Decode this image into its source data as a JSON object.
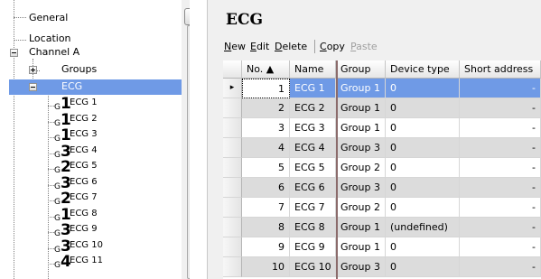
{
  "tree": {
    "top_items": [
      {
        "label": "General"
      },
      {
        "label": "Location"
      },
      {
        "label": "Channel A"
      }
    ],
    "channel_children": [
      {
        "label": "Groups"
      },
      {
        "label": "ECG"
      }
    ],
    "ecg_items": [
      {
        "prefix": "G",
        "num": "1",
        "label": "ECG 1"
      },
      {
        "prefix": "G",
        "num": "1",
        "label": "ECG 2"
      },
      {
        "prefix": "G",
        "num": "1",
        "label": "ECG 3"
      },
      {
        "prefix": "G",
        "num": "3",
        "label": "ECG 4"
      },
      {
        "prefix": "G",
        "num": "2",
        "label": "ECG 5"
      },
      {
        "prefix": "G",
        "num": "3",
        "label": "ECG 6"
      },
      {
        "prefix": "G",
        "num": "2",
        "label": "ECG 7"
      },
      {
        "prefix": "G",
        "num": "1",
        "label": "ECG 8"
      },
      {
        "prefix": "G",
        "num": "3",
        "label": "ECG 9"
      },
      {
        "prefix": "G",
        "num": "3",
        "label": "ECG 10"
      },
      {
        "prefix": "G",
        "num": "4",
        "label": "ECG 11"
      }
    ],
    "scroll_up_icon": "chevron-up-icon",
    "grip_icon": "scrollbar-grip-icon"
  },
  "panel": {
    "title": "ECG"
  },
  "toolbar": {
    "new": {
      "key": "N",
      "rest": "ew"
    },
    "edit": {
      "key": "E",
      "rest": "dit"
    },
    "delete": {
      "key": "D",
      "rest": "elete"
    },
    "copy": {
      "key": "C",
      "rest": "opy"
    },
    "paste": {
      "key": "P",
      "rest": "aste"
    }
  },
  "grid": {
    "columns": [
      "No. ▲",
      "Name",
      "Group",
      "Device type",
      "Short address"
    ],
    "selected_marker": "▸",
    "rows": [
      {
        "no": "1",
        "name": "ECG 1",
        "group": "Group 1",
        "device_type": "0",
        "short_address": "-"
      },
      {
        "no": "2",
        "name": "ECG 2",
        "group": "Group 1",
        "device_type": "0",
        "short_address": "-"
      },
      {
        "no": "3",
        "name": "ECG 3",
        "group": "Group 1",
        "device_type": "0",
        "short_address": "-"
      },
      {
        "no": "4",
        "name": "ECG 4",
        "group": "Group 3",
        "device_type": "0",
        "short_address": "-"
      },
      {
        "no": "5",
        "name": "ECG 5",
        "group": "Group 2",
        "device_type": "0",
        "short_address": "-"
      },
      {
        "no": "6",
        "name": "ECG 6",
        "group": "Group 3",
        "device_type": "0",
        "short_address": "-"
      },
      {
        "no": "7",
        "name": "ECG 7",
        "group": "Group 2",
        "device_type": "0",
        "short_address": "-"
      },
      {
        "no": "8",
        "name": "ECG 8",
        "group": "Group 1",
        "device_type": "(undefined)",
        "short_address": "-"
      },
      {
        "no": "9",
        "name": "ECG 9",
        "group": "Group 1",
        "device_type": "0",
        "short_address": "-"
      },
      {
        "no": "10",
        "name": "ECG 10",
        "group": "Group 3",
        "device_type": "0",
        "short_address": "-"
      }
    ]
  },
  "colors": {
    "selection": "#6f9ae6",
    "alt_row": "#dcdcdc",
    "panel_bg": "#f0f0f0"
  }
}
